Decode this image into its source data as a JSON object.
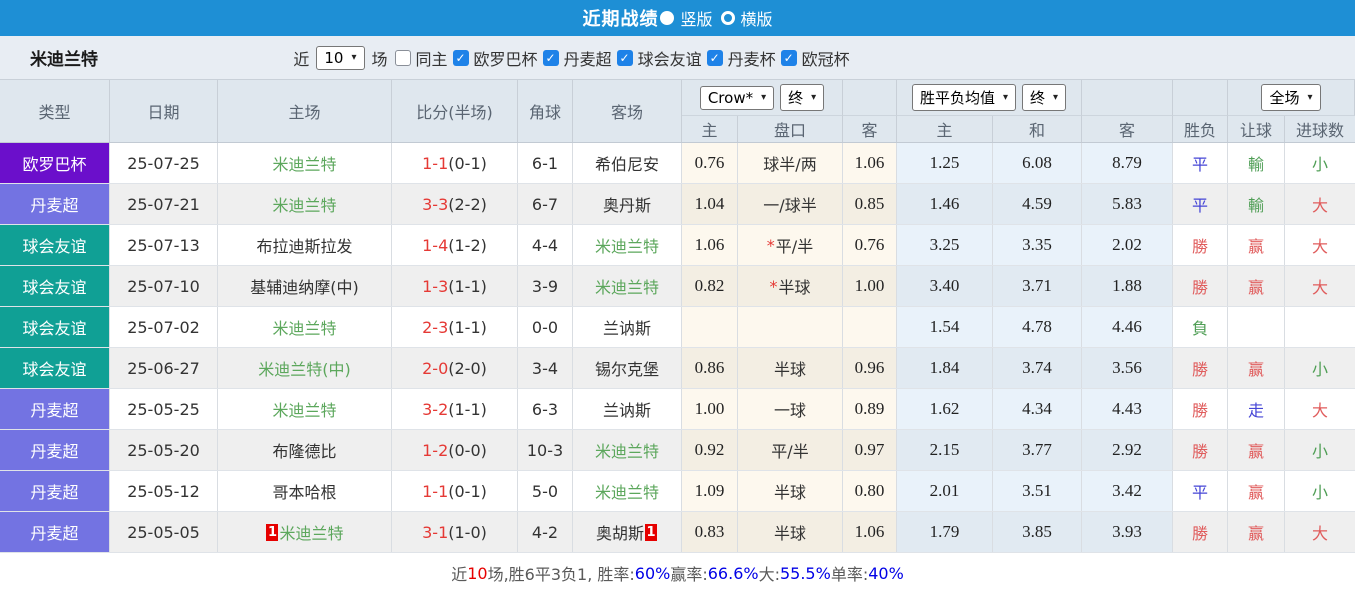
{
  "colors": {
    "topbar": "#1e8fd5",
    "checkbox_blue": "#1e82e8",
    "type_colors": {
      "欧罗巴杯": "#6b0fcb",
      "丹麦超": "#7373e2",
      "球会友谊": "#10a095"
    },
    "result_colors": {
      "red": "#e05c5c",
      "blue": "#4545d6",
      "green": "#4f9e55"
    },
    "team_green": "#5ca75c",
    "score_red": "#e53935"
  },
  "title_bar": {
    "title": "近期战绩",
    "radios": [
      {
        "label": "竖版",
        "selected": true
      },
      {
        "label": "横版",
        "selected": false
      }
    ]
  },
  "filter_bar": {
    "team": "米迪兰特",
    "near": "近",
    "count": "10",
    "games": "场",
    "checks": [
      {
        "label": "同主",
        "checked": false
      },
      {
        "label": "欧罗巴杯",
        "checked": true
      },
      {
        "label": "丹麦超",
        "checked": true
      },
      {
        "label": "球会友谊",
        "checked": true
      },
      {
        "label": "丹麦杯",
        "checked": true
      },
      {
        "label": "欧冠杯",
        "checked": true
      }
    ]
  },
  "thead": {
    "type": "类型",
    "date": "日期",
    "home": "主场",
    "score": "比分(半场)",
    "corner": "角球",
    "away": "客场",
    "selects": {
      "company": "Crow*",
      "final1": "终",
      "avg": "胜平负均值",
      "final2": "终",
      "scope": "全场"
    },
    "sub": [
      "主",
      "盘口",
      "客",
      "主",
      "和",
      "客",
      "胜负",
      "让球",
      "进球数"
    ]
  },
  "rows": [
    {
      "type": "欧罗巴杯",
      "date": "25-07-25",
      "home": "米迪兰特",
      "home_team": true,
      "home_card": "",
      "score": "1-1",
      "half": "(0-1)",
      "corner": "6-1",
      "away": "希伯尼安",
      "away_team": false,
      "away_card": "",
      "ah": [
        "0.76",
        "球半/两",
        "1.06"
      ],
      "ah_star": false,
      "eu": [
        "1.25",
        "6.08",
        "8.79"
      ],
      "res": [
        "平",
        "blue"
      ],
      "let": [
        "輸",
        "green"
      ],
      "goal": [
        "小",
        "green"
      ]
    },
    {
      "type": "丹麦超",
      "date": "25-07-21",
      "home": "米迪兰特",
      "home_team": true,
      "home_card": "",
      "score": "3-3",
      "half": "(2-2)",
      "corner": "6-7",
      "away": "奥丹斯",
      "away_team": false,
      "away_card": "",
      "ah": [
        "1.04",
        "一/球半",
        "0.85"
      ],
      "ah_star": false,
      "eu": [
        "1.46",
        "4.59",
        "5.83"
      ],
      "res": [
        "平",
        "blue"
      ],
      "let": [
        "輸",
        "green"
      ],
      "goal": [
        "大",
        "red"
      ]
    },
    {
      "type": "球会友谊",
      "date": "25-07-13",
      "home": "布拉迪斯拉发",
      "home_team": false,
      "home_card": "",
      "score": "1-4",
      "half": "(1-2)",
      "corner": "4-4",
      "away": "米迪兰特",
      "away_team": true,
      "away_card": "",
      "ah": [
        "1.06",
        "平/半",
        "0.76"
      ],
      "ah_star": true,
      "eu": [
        "3.25",
        "3.35",
        "2.02"
      ],
      "res": [
        "勝",
        "red"
      ],
      "let": [
        "赢",
        "red"
      ],
      "goal": [
        "大",
        "red"
      ]
    },
    {
      "type": "球会友谊",
      "date": "25-07-10",
      "home": "基辅迪纳摩(中)",
      "home_team": false,
      "home_card": "",
      "score": "1-3",
      "half": "(1-1)",
      "corner": "3-9",
      "away": "米迪兰特",
      "away_team": true,
      "away_card": "",
      "ah": [
        "0.82",
        "半球",
        "1.00"
      ],
      "ah_star": true,
      "eu": [
        "3.40",
        "3.71",
        "1.88"
      ],
      "res": [
        "勝",
        "red"
      ],
      "let": [
        "赢",
        "red"
      ],
      "goal": [
        "大",
        "red"
      ]
    },
    {
      "type": "球会友谊",
      "date": "25-07-02",
      "home": "米迪兰特",
      "home_team": true,
      "home_card": "",
      "score": "2-3",
      "half": "(1-1)",
      "corner": "0-0",
      "away": "兰讷斯",
      "away_team": false,
      "away_card": "",
      "ah": [
        "",
        "",
        ""
      ],
      "ah_star": false,
      "eu": [
        "1.54",
        "4.78",
        "4.46"
      ],
      "res": [
        "負",
        "green"
      ],
      "let": [
        "",
        ""
      ],
      "goal": [
        "",
        ""
      ]
    },
    {
      "type": "球会友谊",
      "date": "25-06-27",
      "home": "米迪兰特(中)",
      "home_team": true,
      "home_card": "",
      "score": "2-0",
      "half": "(2-0)",
      "corner": "3-4",
      "away": "锡尔克堡",
      "away_team": false,
      "away_card": "",
      "ah": [
        "0.86",
        "半球",
        "0.96"
      ],
      "ah_star": false,
      "eu": [
        "1.84",
        "3.74",
        "3.56"
      ],
      "res": [
        "勝",
        "red"
      ],
      "let": [
        "赢",
        "red"
      ],
      "goal": [
        "小",
        "green"
      ]
    },
    {
      "type": "丹麦超",
      "date": "25-05-25",
      "home": "米迪兰特",
      "home_team": true,
      "home_card": "",
      "score": "3-2",
      "half": "(1-1)",
      "corner": "6-3",
      "away": "兰讷斯",
      "away_team": false,
      "away_card": "",
      "ah": [
        "1.00",
        "一球",
        "0.89"
      ],
      "ah_star": false,
      "eu": [
        "1.62",
        "4.34",
        "4.43"
      ],
      "res": [
        "勝",
        "red"
      ],
      "let": [
        "走",
        "blue"
      ],
      "goal": [
        "大",
        "red"
      ]
    },
    {
      "type": "丹麦超",
      "date": "25-05-20",
      "home": "布隆德比",
      "home_team": false,
      "home_card": "",
      "score": "1-2",
      "half": "(0-0)",
      "corner": "10-3",
      "away": "米迪兰特",
      "away_team": true,
      "away_card": "",
      "ah": [
        "0.92",
        "平/半",
        "0.97"
      ],
      "ah_star": false,
      "eu": [
        "2.15",
        "3.77",
        "2.92"
      ],
      "res": [
        "勝",
        "red"
      ],
      "let": [
        "赢",
        "red"
      ],
      "goal": [
        "小",
        "green"
      ]
    },
    {
      "type": "丹麦超",
      "date": "25-05-12",
      "home": "哥本哈根",
      "home_team": false,
      "home_card": "",
      "score": "1-1",
      "half": "(0-1)",
      "corner": "5-0",
      "away": "米迪兰特",
      "away_team": true,
      "away_card": "",
      "ah": [
        "1.09",
        "半球",
        "0.80"
      ],
      "ah_star": false,
      "eu": [
        "2.01",
        "3.51",
        "3.42"
      ],
      "res": [
        "平",
        "blue"
      ],
      "let": [
        "赢",
        "red"
      ],
      "goal": [
        "小",
        "green"
      ]
    },
    {
      "type": "丹麦超",
      "date": "25-05-05",
      "home": "米迪兰特",
      "home_team": true,
      "home_card": "1",
      "score": "3-1",
      "half": "(1-0)",
      "corner": "4-2",
      "away": "奥胡斯",
      "away_team": false,
      "away_card": "1",
      "ah": [
        "0.83",
        "半球",
        "1.06"
      ],
      "ah_star": false,
      "eu": [
        "1.79",
        "3.85",
        "3.93"
      ],
      "res": [
        "勝",
        "red"
      ],
      "let": [
        "赢",
        "red"
      ],
      "goal": [
        "大",
        "red"
      ]
    }
  ],
  "footer": {
    "segments": [
      {
        "t": "近",
        "c": "gray"
      },
      {
        "t": "10",
        "c": "red"
      },
      {
        "t": "场,胜6平3负1, 胜率:",
        "c": "gray"
      },
      {
        "t": "60%",
        "c": "blue"
      },
      {
        "t": " 赢率:",
        "c": "gray"
      },
      {
        "t": "66.6%",
        "c": "blue"
      },
      {
        "t": " 大:",
        "c": "gray"
      },
      {
        "t": "55.5%",
        "c": "blue"
      },
      {
        "t": " 单率:",
        "c": "gray"
      },
      {
        "t": "40%",
        "c": "blue"
      }
    ]
  }
}
